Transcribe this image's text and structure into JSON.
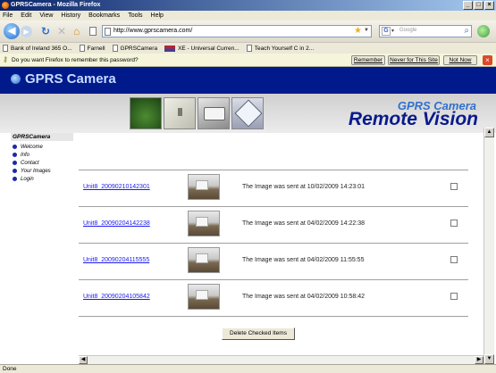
{
  "window": {
    "title": "GPRSCamera - Mozilla Firefox",
    "controls": [
      "_",
      "□",
      "×"
    ]
  },
  "menu": [
    "File",
    "Edit",
    "View",
    "History",
    "Bookmarks",
    "Tools",
    "Help"
  ],
  "nav": {
    "url": "http://www.gprscamera.com/",
    "search_placeholder": "Google"
  },
  "bookmarks": [
    {
      "label": "Bank of Ireland 365 O..."
    },
    {
      "label": "Farnell"
    },
    {
      "label": "GPRSCamera"
    },
    {
      "label": "XE - Universal Curren..."
    },
    {
      "label": "Teach Yourself C in 2..."
    }
  ],
  "notification": {
    "message": "Do you want Firefox to remember this password?",
    "remember": "Remember",
    "never": "Never for This Site",
    "not_now": "Not Now"
  },
  "page": {
    "banner_title": "GPRS Camera",
    "rv_line1": "GPRS Camera",
    "rv_line2": "Remote Vision",
    "sidebar_title": "GPRSCamera",
    "sidebar_items": [
      "Welcome",
      "Info",
      "Contact",
      "Your Images",
      "Login"
    ],
    "images": [
      {
        "name": "Unit8_20090210142301",
        "text": "The Image was sent at 10/02/2009 14:23:01"
      },
      {
        "name": "Unit8_20090204142238",
        "text": "The Image was sent at 04/02/2009 14:22:38"
      },
      {
        "name": "Unit8_20090204115555",
        "text": "The Image was sent at 04/02/2009 11:55:55"
      },
      {
        "name": "Unit8_20090204105842",
        "text": "The Image was sent at 04/02/2009 10:58:42"
      }
    ],
    "delete_button": "Delete Checked Items"
  },
  "status": "Done"
}
